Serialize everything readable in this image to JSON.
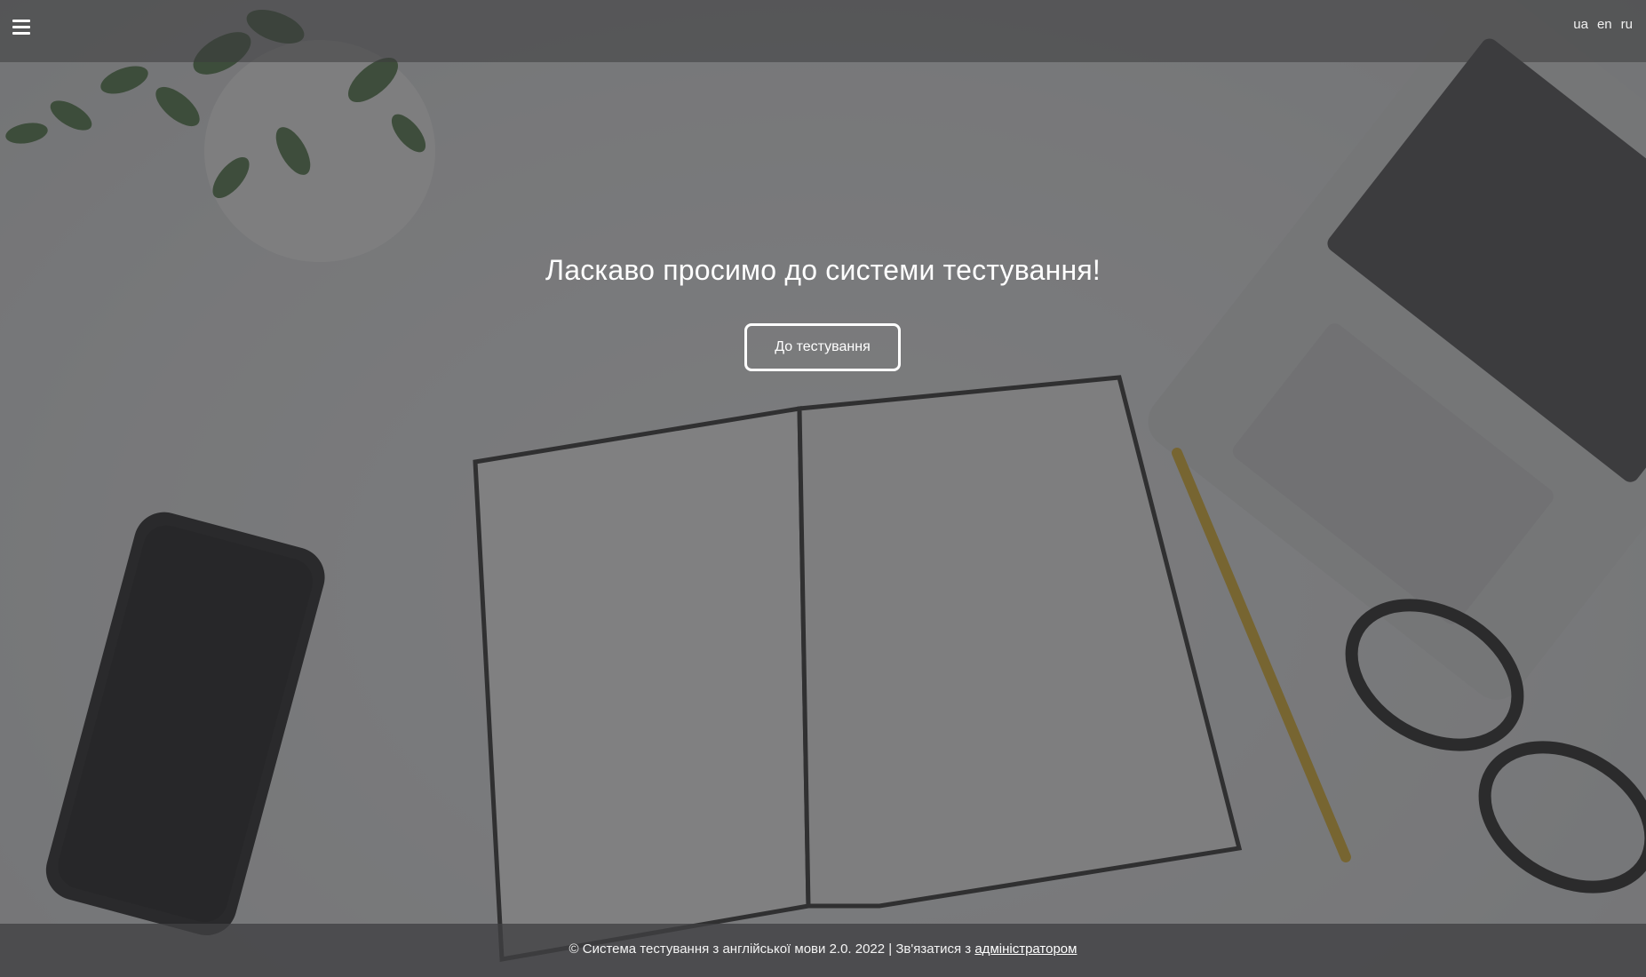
{
  "header": {
    "languages": [
      "ua",
      "en",
      "ru"
    ]
  },
  "hero": {
    "title": "Ласкаво просимо до системи тестування!",
    "button_label": "До тестування"
  },
  "footer": {
    "text": "© Система тестування з англійської мови 2.0. 2022 | Зв'язатися з ",
    "link_label": "адміністратором"
  },
  "icons": {
    "menu": "hamburger-menu-icon"
  }
}
